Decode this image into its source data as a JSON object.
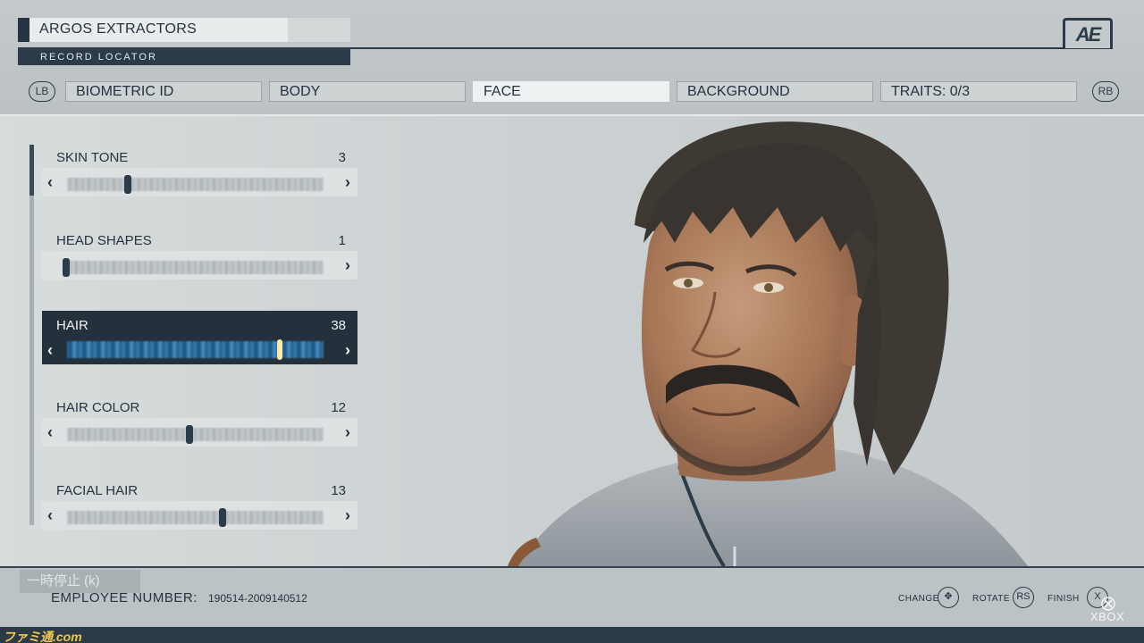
{
  "header": {
    "company_name": "ARGOS EXTRACTORS",
    "record_label": "RECORD LOCATOR",
    "logo_text": "AE"
  },
  "tabs": {
    "left_bumper": "LB",
    "right_bumper": "RB",
    "items": [
      {
        "label": "BIOMETRIC ID",
        "active": false
      },
      {
        "label": "BODY",
        "active": false
      },
      {
        "label": "FACE",
        "active": true
      },
      {
        "label": "BACKGROUND",
        "active": false
      },
      {
        "label": "TRAITS: 0/3",
        "active": false
      }
    ]
  },
  "options": [
    {
      "label": "SKIN TONE",
      "value": "3",
      "selected": false
    },
    {
      "label": "HEAD SHAPES",
      "value": "1",
      "selected": false
    },
    {
      "label": "HAIR",
      "value": "38",
      "selected": true
    },
    {
      "label": "HAIR COLOR",
      "value": "12",
      "selected": false
    },
    {
      "label": "FACIAL HAIR",
      "value": "13",
      "selected": false
    }
  ],
  "arrows": {
    "left": "‹",
    "right": "›"
  },
  "footer": {
    "pause_label": "一時停止 (k)",
    "employee_label": "EMPLOYEE NUMBER:",
    "employee_number": "190514-2009140512",
    "controls": [
      {
        "label": "CHANGE",
        "button": "✥"
      },
      {
        "label": "ROTATE",
        "button": "RS"
      },
      {
        "label": "FINISH",
        "button": "X"
      }
    ]
  },
  "watermarks": {
    "famitsu": "ファミ通.com",
    "xbox": "XBOX"
  },
  "colors": {
    "panel_dark": "#24313d",
    "accent_highlight": "#ffe9a8",
    "background": "#ccd2d3"
  },
  "icons": {
    "xbox": "xbox-logo-icon",
    "dpad": "dpad-icon"
  }
}
